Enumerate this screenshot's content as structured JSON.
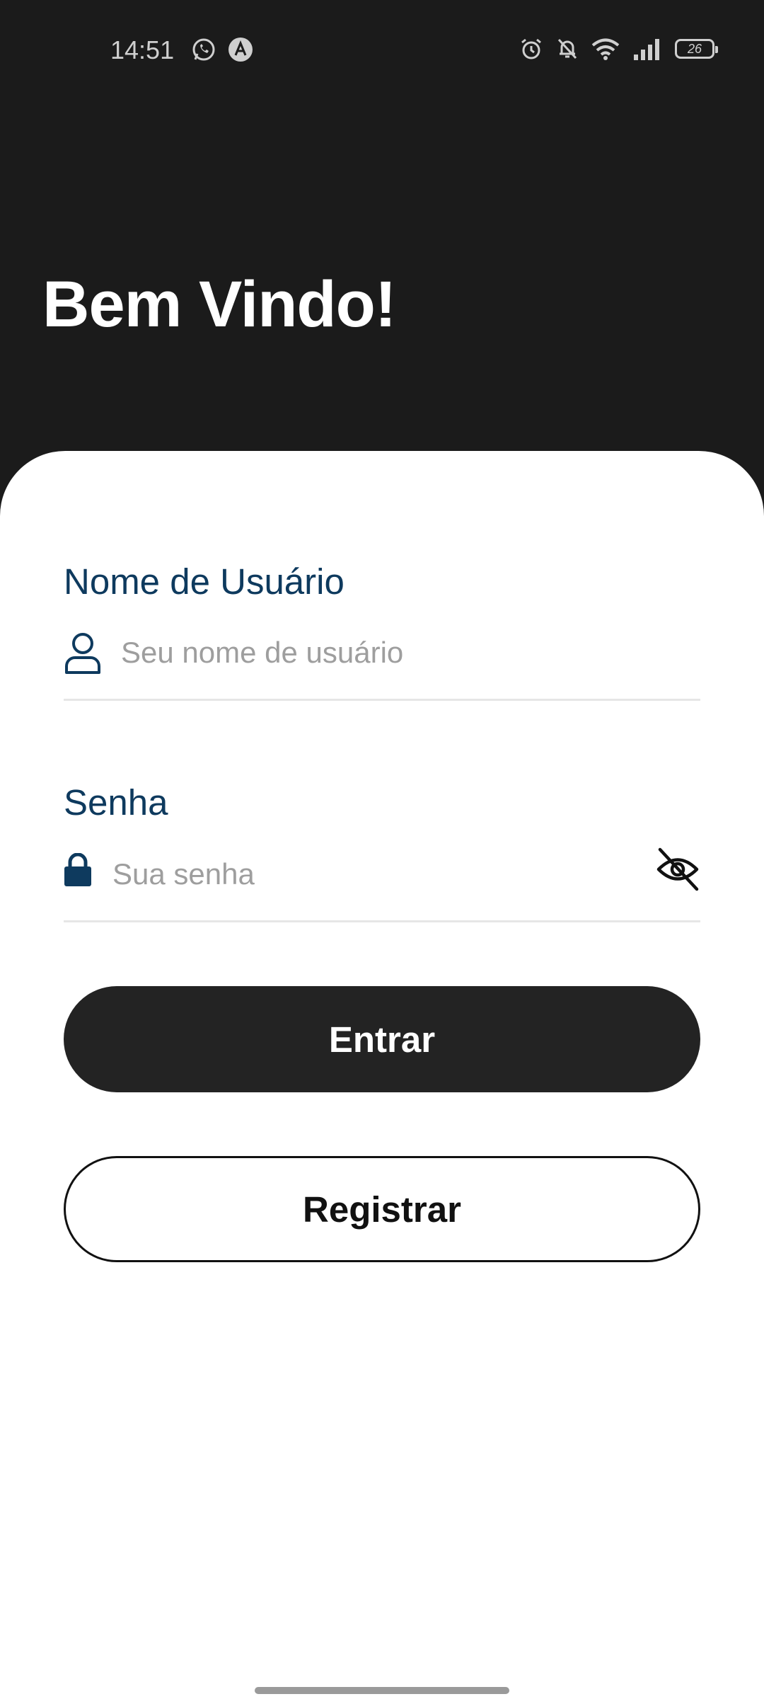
{
  "status_bar": {
    "time": "14:51",
    "left_icons": [
      "whatsapp-icon",
      "app-notification-icon"
    ],
    "right_icons": [
      "alarm-icon",
      "bell-off-icon",
      "wifi-icon",
      "signal-icon",
      "battery-icon"
    ],
    "battery_level": "26"
  },
  "header": {
    "title": "Bem Vindo!"
  },
  "form": {
    "username": {
      "label": "Nome de Usuário",
      "placeholder": "Seu nome de usuário",
      "value": "",
      "icon": "user-icon"
    },
    "password": {
      "label": "Senha",
      "placeholder": "Sua senha",
      "value": "",
      "icon": "lock-icon",
      "toggle_icon": "eye-off-icon"
    }
  },
  "buttons": {
    "login_label": "Entrar",
    "register_label": "Registrar"
  },
  "colors": {
    "header_bg": "#1b1b1b",
    "sheet_bg": "#ffffff",
    "label_color": "#0e3a5e",
    "primary_button": "#232323",
    "placeholder": "#9e9e9e"
  }
}
